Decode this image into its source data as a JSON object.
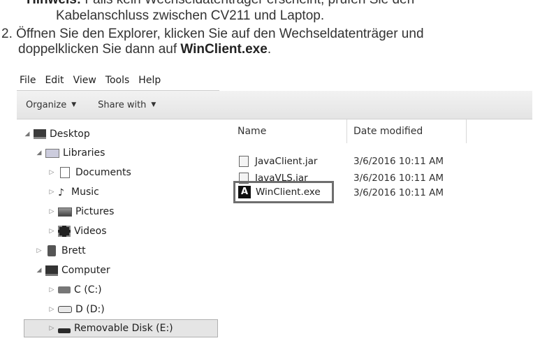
{
  "document": {
    "line1_bold": "Hinweis:",
    "line1_rest": " Falls kein Wechseldatenträger erscheint, prüfen Sie den",
    "line2": "Kabelanschluss zwischen CV211 und Laptop.",
    "line3": "2. Öffnen Sie den Explorer, klicken Sie auf den Wechseldatenträger und",
    "line4_pre": "doppelklicken Sie dann auf ",
    "line4_bold": "WinClient.exe",
    "line4_post": "."
  },
  "explorer": {
    "menu": [
      "File",
      "Edit",
      "View",
      "Tools",
      "Help"
    ],
    "toolbar": {
      "organize": "Organize",
      "share_with": "Share with"
    },
    "tree": [
      {
        "label": "Desktop",
        "icon": "desktop-icon"
      },
      {
        "label": "Libraries",
        "icon": "libraries-icon"
      },
      {
        "label": "Documents",
        "icon": "documents-icon"
      },
      {
        "label": "Music",
        "icon": "music-icon"
      },
      {
        "label": "Pictures",
        "icon": "pictures-icon"
      },
      {
        "label": "Videos",
        "icon": "videos-icon"
      },
      {
        "label": "Brett",
        "icon": "user-folder-icon"
      },
      {
        "label": "Computer",
        "icon": "computer-icon"
      },
      {
        "label": "C (C:)",
        "icon": "hard-drive-icon"
      },
      {
        "label": "D (D:)",
        "icon": "drive-icon"
      },
      {
        "label": "Removable Disk (E:)",
        "icon": "removable-disk-icon"
      }
    ],
    "columns": {
      "name": "Name",
      "date_modified": "Date modified"
    },
    "files": [
      {
        "name": "JavaClient.jar",
        "date": "3/6/2016 10:11 AM",
        "icon": "jar-file-icon"
      },
      {
        "name": "JavaVLS.jar",
        "date": "3/6/2016 10:11 AM",
        "icon": "jar-file-icon"
      },
      {
        "name": "WinClient.exe",
        "date": "3/6/2016 10:11 AM",
        "icon": "exe-app-icon"
      }
    ]
  }
}
